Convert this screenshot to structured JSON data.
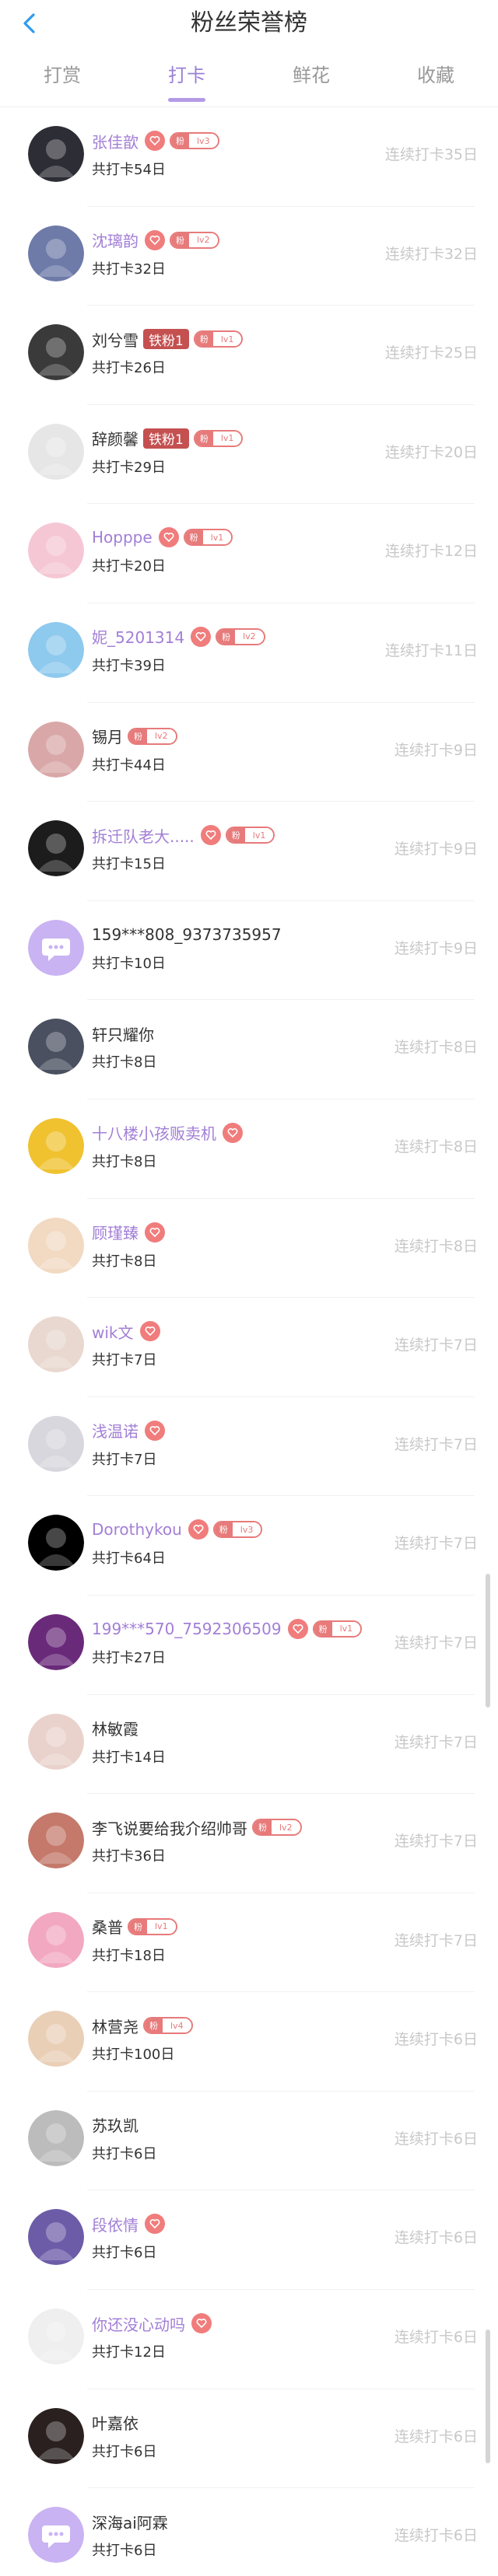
{
  "header": {
    "title": "粉丝荣誉榜"
  },
  "tabs": [
    {
      "label": "打赏",
      "active": false
    },
    {
      "label": "打卡",
      "active": true
    },
    {
      "label": "鲜花",
      "active": false
    },
    {
      "label": "收藏",
      "active": false
    }
  ],
  "colors": {
    "accent": "#9a80d6",
    "fan_badge": "#e77a7a",
    "title_badge": "#c45050",
    "muted": "#c8c8c8"
  },
  "list": [
    {
      "name": "张佳歆",
      "name_style": "purple",
      "heart": true,
      "fan_level": "lv3",
      "title_badge": "",
      "total": "共打卡54日",
      "streak": "连续打卡35日",
      "avatar_color": "#2d2d35"
    },
    {
      "name": "沈璃韵",
      "name_style": "purple",
      "heart": true,
      "fan_level": "lv2",
      "title_badge": "",
      "total": "共打卡32日",
      "streak": "连续打卡32日",
      "avatar_color": "#6e7aa8"
    },
    {
      "name": "刘兮雪",
      "name_style": "normal",
      "heart": false,
      "fan_level": "lv1",
      "title_badge": "铁粉1",
      "total": "共打卡26日",
      "streak": "连续打卡25日",
      "avatar_color": "#3a3a3a"
    },
    {
      "name": "辞颜馨",
      "name_style": "normal",
      "heart": false,
      "fan_level": "lv1",
      "title_badge": "铁粉1",
      "total": "共打卡29日",
      "streak": "连续打卡20日",
      "avatar_color": "#e6e6e6"
    },
    {
      "name": "Hopppe",
      "name_style": "purple",
      "heart": true,
      "fan_level": "lv1",
      "title_badge": "",
      "total": "共打卡20日",
      "streak": "连续打卡12日",
      "avatar_color": "#f5c7d4"
    },
    {
      "name": "妮_5201314",
      "name_style": "purple",
      "heart": true,
      "fan_level": "lv2",
      "title_badge": "",
      "total": "共打卡39日",
      "streak": "连续打卡11日",
      "avatar_color": "#8ec9ee"
    },
    {
      "name": "锡月",
      "name_style": "normal",
      "heart": false,
      "fan_level": "lv2",
      "title_badge": "",
      "total": "共打卡44日",
      "streak": "连续打卡9日",
      "avatar_color": "#d9a7a7"
    },
    {
      "name": "拆迁队老大.....",
      "name_style": "purple",
      "heart": true,
      "fan_level": "lv1",
      "title_badge": "",
      "total": "共打卡15日",
      "streak": "连续打卡9日",
      "avatar_color": "#1c1c1c"
    },
    {
      "name": "159***808_9373735957",
      "name_style": "normal",
      "heart": false,
      "fan_level": "",
      "title_badge": "",
      "total": "共打卡10日",
      "streak": "连续打卡9日",
      "avatar_color": "#c9b3f2",
      "default_avatar": true
    },
    {
      "name": "轩只耀你",
      "name_style": "normal",
      "heart": false,
      "fan_level": "",
      "title_badge": "",
      "total": "共打卡8日",
      "streak": "连续打卡8日",
      "avatar_color": "#4a5060"
    },
    {
      "name": "十八楼小孩贩卖机",
      "name_style": "purple",
      "heart": true,
      "fan_level": "",
      "title_badge": "",
      "total": "共打卡8日",
      "streak": "连续打卡8日",
      "avatar_color": "#f0c230"
    },
    {
      "name": "顾瑾臻",
      "name_style": "purple",
      "heart": true,
      "fan_level": "",
      "title_badge": "",
      "total": "共打卡8日",
      "streak": "连续打卡8日",
      "avatar_color": "#f1d9c2"
    },
    {
      "name": "wik文",
      "name_style": "purple",
      "heart": true,
      "fan_level": "",
      "title_badge": "",
      "total": "共打卡7日",
      "streak": "连续打卡7日",
      "avatar_color": "#e8d8cf"
    },
    {
      "name": "浅温诺",
      "name_style": "purple",
      "heart": true,
      "fan_level": "",
      "title_badge": "",
      "total": "共打卡7日",
      "streak": "连续打卡7日",
      "avatar_color": "#d7d7dd"
    },
    {
      "name": "Dorothykou",
      "name_style": "purple",
      "heart": true,
      "fan_level": "lv3",
      "title_badge": "",
      "total": "共打卡64日",
      "streak": "连续打卡7日",
      "avatar_color": "#000000"
    },
    {
      "name": "199***570_7592306509",
      "name_style": "purple",
      "heart": true,
      "fan_level": "lv1",
      "title_badge": "",
      "total": "共打卡27日",
      "streak": "连续打卡7日",
      "avatar_color": "#6a2a7a"
    },
    {
      "name": "林敏霞",
      "name_style": "normal",
      "heart": false,
      "fan_level": "",
      "title_badge": "",
      "total": "共打卡14日",
      "streak": "连续打卡7日",
      "avatar_color": "#ead2cc"
    },
    {
      "name": "李飞说要给我介绍帅哥",
      "name_style": "normal",
      "heart": false,
      "fan_level": "lv2",
      "title_badge": "",
      "total": "共打卡36日",
      "streak": "连续打卡7日",
      "avatar_color": "#c4796b"
    },
    {
      "name": "桑普",
      "name_style": "normal",
      "heart": false,
      "fan_level": "lv1",
      "title_badge": "",
      "total": "共打卡18日",
      "streak": "连续打卡7日",
      "avatar_color": "#f2a8c0"
    },
    {
      "name": "林营尧",
      "name_style": "normal",
      "heart": false,
      "fan_level": "lv4",
      "title_badge": "",
      "total": "共打卡100日",
      "streak": "连续打卡6日",
      "avatar_color": "#e9cfb6"
    },
    {
      "name": "苏玖凯",
      "name_style": "normal",
      "heart": false,
      "fan_level": "",
      "title_badge": "",
      "total": "共打卡6日",
      "streak": "连续打卡6日",
      "avatar_color": "#bcbcbc"
    },
    {
      "name": "段依情",
      "name_style": "purple",
      "heart": true,
      "fan_level": "",
      "title_badge": "",
      "total": "共打卡6日",
      "streak": "连续打卡6日",
      "avatar_color": "#6c5ca8"
    },
    {
      "name": "你还没心动吗",
      "name_style": "purple",
      "heart": true,
      "fan_level": "",
      "title_badge": "",
      "total": "共打卡12日",
      "streak": "连续打卡6日",
      "avatar_color": "#efefef"
    },
    {
      "name": "叶嘉依",
      "name_style": "normal",
      "heart": false,
      "fan_level": "",
      "title_badge": "",
      "total": "共打卡6日",
      "streak": "连续打卡6日",
      "avatar_color": "#2a2020"
    },
    {
      "name": "深海ai阿霖",
      "name_style": "normal",
      "heart": false,
      "fan_level": "",
      "title_badge": "",
      "total": "共打卡6日",
      "streak": "连续打卡6日",
      "avatar_color": "#c9b3f2",
      "default_avatar": true
    }
  ]
}
